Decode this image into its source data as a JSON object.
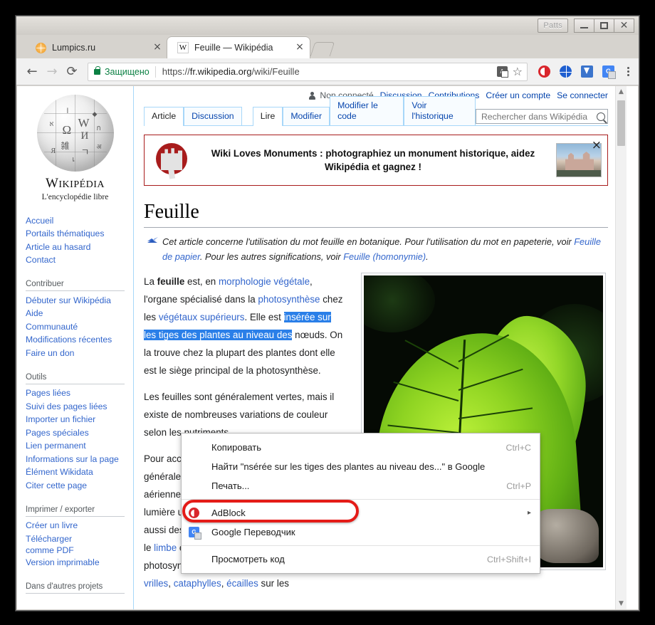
{
  "window": {
    "caption_buttons": {
      "patts_label": "Patts",
      "minimize": "minimize",
      "maximize": "maximize",
      "close": "close"
    }
  },
  "browser": {
    "tabs": [
      {
        "title": "Lumpics.ru",
        "favicon": "orange-circle-icon",
        "active": false,
        "close_label": "×"
      },
      {
        "title": "Feuille — Wikipédia",
        "favicon": "wikipedia-w-icon",
        "active": true,
        "close_label": "×"
      }
    ],
    "new_tab_label": "",
    "nav": {
      "back": "←",
      "forward": "→",
      "reload": "⟳"
    },
    "omnibox": {
      "security_label": "Защищено",
      "url_scheme": "https://",
      "url_host": "fr.wikipedia.org",
      "url_path": "/wiki/Feuille",
      "translate_icon": "translate-icon",
      "bookmark_icon": "star-icon"
    },
    "extensions": [
      {
        "name": "adblock-icon",
        "label": "AdBlock"
      },
      {
        "name": "globe-icon",
        "label": ""
      },
      {
        "name": "download-icon",
        "label": ""
      },
      {
        "name": "google-translate-icon",
        "label": ""
      }
    ],
    "menu_icon": "kebab-menu-icon"
  },
  "wiki": {
    "logo": {
      "wordmark_w": "W",
      "wordmark_rest": "IKIPÉDIA",
      "tagline": "L'encyclopédie libre"
    },
    "user_links": {
      "status": "Non connecté",
      "links": [
        "Discussion",
        "Contributions",
        "Créer un compte",
        "Se connecter"
      ]
    },
    "page_tabs": [
      {
        "label": "Article",
        "selected": true
      },
      {
        "label": "Discussion",
        "selected": false
      }
    ],
    "action_tabs": [
      {
        "label": "Lire",
        "selected": true
      },
      {
        "label": "Modifier",
        "selected": false
      },
      {
        "label": "Modifier le code",
        "selected": false
      },
      {
        "label": "Voir l'historique",
        "selected": false
      }
    ],
    "search": {
      "placeholder": "Rechercher dans Wikipédia",
      "value": "",
      "icon": "search-icon"
    },
    "banner": {
      "text": "Wiki Loves Monuments : photographiez un monument historique, aidez Wikipédia et gagnez !",
      "close_label": "×",
      "accent_color": "#a81c1c"
    },
    "sidebar": [
      {
        "heading": "",
        "items": [
          "Accueil",
          "Portails thématiques",
          "Article au hasard",
          "Contact"
        ]
      },
      {
        "heading": "Contribuer",
        "items": [
          "Débuter sur Wikipédia",
          "Aide",
          "Communauté",
          "Modifications récentes",
          "Faire un don"
        ]
      },
      {
        "heading": "Outils",
        "items": [
          "Pages liées",
          "Suivi des pages liées",
          "Importer un fichier",
          "Pages spéciales",
          "Lien permanent",
          "Informations sur la page",
          "Élément Wikidata",
          "Citer cette page"
        ]
      },
      {
        "heading": "Imprimer / exporter",
        "items": [
          "Créer un livre",
          "Télécharger comme PDF",
          "Version imprimable"
        ]
      },
      {
        "heading": "Dans d'autres projets",
        "items": []
      }
    ],
    "article": {
      "title": "Feuille",
      "hatnote_part1": "Cet article concerne l'utilisation du mot feuille en botanique. Pour l'utilisation du mot en papeterie, voir ",
      "hatnote_link1": "Feuille de papier",
      "hatnote_part2": ". Pour les autres significations, voir ",
      "hatnote_link2": "Feuille (homonymie)",
      "hatnote_part3": ".",
      "p1_a": "La ",
      "p1_bold": "feuille",
      "p1_b": " est, en ",
      "p1_link1": "morphologie végétale",
      "p1_c": ", l'organe spécialisé dans la ",
      "p1_link2": "photosynthèse",
      "p1_d": " chez les ",
      "p1_link3": "végétaux supérieurs",
      "p1_e": ". Elle est ",
      "p1_selected": "insérée sur les tiges des plantes au niveau des",
      "p1_f": " nœuds. On la trouve chez la plupart des plantes dont elle est le siège principal de la photosynthèse.",
      "p2_a": "Les feuilles sont généralement vertes, mais il existe de nombreuses variations de couleur selon les nutriments.",
      "p3_a": "Pour accomplir son rôle, une feuille est généralement formée d'une lame plate et fine aérienne, le ",
      "p3_link1": "limbe",
      "p3_b": ", qui lui permet d'exposer à la lumière un maximum de surface. Mais il existe aussi des feuilles transformées, pour lesquelles le ",
      "p3_link2": "limbe",
      "p3_c": " est très réduit en ne joue plus de rôle photosynthétique ; elles sont transformées en ",
      "p3_link3": "vrilles",
      "p3_d": ", ",
      "p3_link4": "cataphylles",
      "p3_e": ", ",
      "p3_link5": "écailles",
      "p3_f": " sur les"
    },
    "figure": {
      "alt": "leaf-photo"
    }
  },
  "context_menu": {
    "items": [
      {
        "label": "Копировать",
        "accel": "Ctrl+C",
        "icon": "",
        "separator_after": false
      },
      {
        "label": "Найти \"nsérée sur les tiges des plantes au niveau des...\" в Google",
        "accel": "",
        "icon": "",
        "separator_after": false
      },
      {
        "label": "Печать...",
        "accel": "Ctrl+P",
        "icon": "",
        "separator_after": true
      },
      {
        "label": "AdBlock",
        "accel": "▸",
        "icon": "adblock-icon",
        "separator_after": false
      },
      {
        "label": "Google Переводчик",
        "accel": "",
        "icon": "google-translate-icon",
        "separator_after": true,
        "highlighted": true
      },
      {
        "label": "Просмотреть код",
        "accel": "Ctrl+Shift+I",
        "icon": "",
        "separator_after": false
      }
    ],
    "highlight_color": "#e41b17"
  },
  "scrollbar": {
    "up_arrow": "▲",
    "down_arrow": "▼"
  }
}
